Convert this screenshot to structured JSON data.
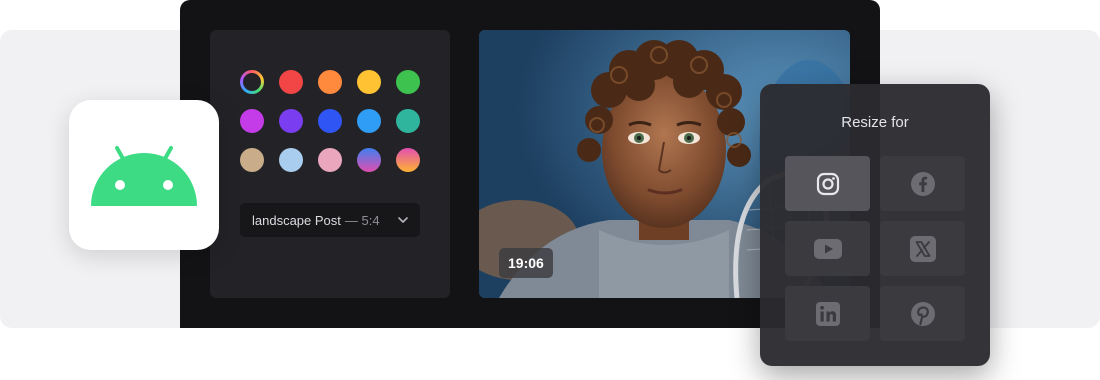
{
  "colors": {
    "band": "#f1f1f3",
    "window": "#131316",
    "panel": "#232327",
    "android_green": "#3ddc84"
  },
  "palette": {
    "swatches": [
      {
        "name": "color-wheel",
        "color": "conic"
      },
      {
        "name": "red",
        "color": "#f24646"
      },
      {
        "name": "orange",
        "color": "#ff8a3d"
      },
      {
        "name": "yellow",
        "color": "#ffc233"
      },
      {
        "name": "green",
        "color": "#3ec24f"
      },
      {
        "name": "magenta",
        "color": "#c43be8"
      },
      {
        "name": "violet",
        "color": "#7a3ef0"
      },
      {
        "name": "blue",
        "color": "#2f55f5"
      },
      {
        "name": "sky",
        "color": "#2f9cf5"
      },
      {
        "name": "teal",
        "color": "#2fb59e"
      },
      {
        "name": "tan",
        "color": "#c9ad8a"
      },
      {
        "name": "light-blue",
        "color": "#a9cdef"
      },
      {
        "name": "pink",
        "color": "#eaa6bd"
      },
      {
        "name": "blue-pink-gradient",
        "color": "linear-gradient(180deg,#3f7ff0,#e04fb0)"
      },
      {
        "name": "pink-orange-gradient",
        "color": "linear-gradient(180deg,#e04fb0,#ffb233)"
      }
    ]
  },
  "format": {
    "label": "landscape Post",
    "ratio": "— 5:4",
    "icon": "chevron-down-icon"
  },
  "preview": {
    "timestamp": "19:06"
  },
  "android": {
    "icon": "android-icon"
  },
  "resize": {
    "title": "Resize for",
    "platforms": [
      {
        "name": "instagram",
        "icon": "instagram-icon",
        "active": true
      },
      {
        "name": "facebook",
        "icon": "facebook-icon",
        "active": false
      },
      {
        "name": "youtube",
        "icon": "youtube-icon",
        "active": false
      },
      {
        "name": "x",
        "icon": "x-icon",
        "active": false
      },
      {
        "name": "linkedin",
        "icon": "linkedin-icon",
        "active": false
      },
      {
        "name": "pinterest",
        "icon": "pinterest-icon",
        "active": false
      }
    ]
  }
}
